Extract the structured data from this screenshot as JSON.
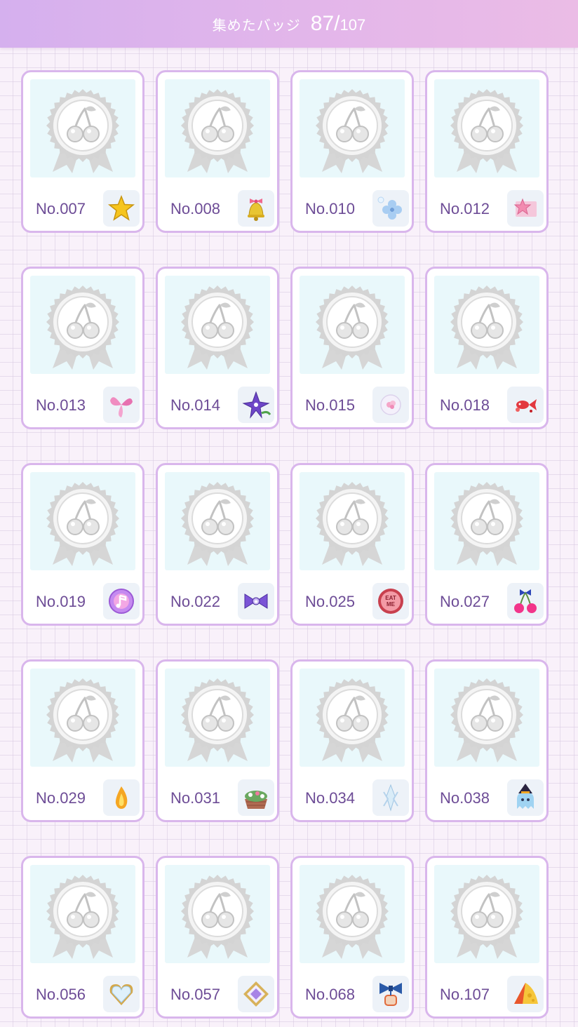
{
  "header": {
    "label": "集めたバッジ",
    "collected": "87",
    "separator": "/",
    "total": "107"
  },
  "badges": [
    {
      "number": "No.007",
      "icon": "star-icon"
    },
    {
      "number": "No.008",
      "icon": "bell-icon"
    },
    {
      "number": "No.010",
      "icon": "hydrangea-icon"
    },
    {
      "number": "No.012",
      "icon": "star-envelope-icon"
    },
    {
      "number": "No.013",
      "icon": "pink-butterfly-icon"
    },
    {
      "number": "No.014",
      "icon": "purple-flower-icon"
    },
    {
      "number": "No.015",
      "icon": "flower-bubble-icon"
    },
    {
      "number": "No.018",
      "icon": "goldfish-icon"
    },
    {
      "number": "No.019",
      "icon": "music-note-orb-icon"
    },
    {
      "number": "No.022",
      "icon": "purple-ribbon-icon"
    },
    {
      "number": "No.025",
      "icon": "eat-me-cookie-icon"
    },
    {
      "number": "No.027",
      "icon": "cherry-ribbon-icon"
    },
    {
      "number": "No.029",
      "icon": "flame-icon"
    },
    {
      "number": "No.031",
      "icon": "flower-basket-icon"
    },
    {
      "number": "No.034",
      "icon": "ice-crystal-icon"
    },
    {
      "number": "No.038",
      "icon": "ghost-witch-hat-icon"
    },
    {
      "number": "No.056",
      "icon": "heart-gem-icon"
    },
    {
      "number": "No.057",
      "icon": "purple-gem-icon"
    },
    {
      "number": "No.068",
      "icon": "blue-bow-icon"
    },
    {
      "number": "No.107",
      "icon": "cheese-icon"
    }
  ],
  "placeholder_badge": "cherry-seal-placeholder-icon"
}
